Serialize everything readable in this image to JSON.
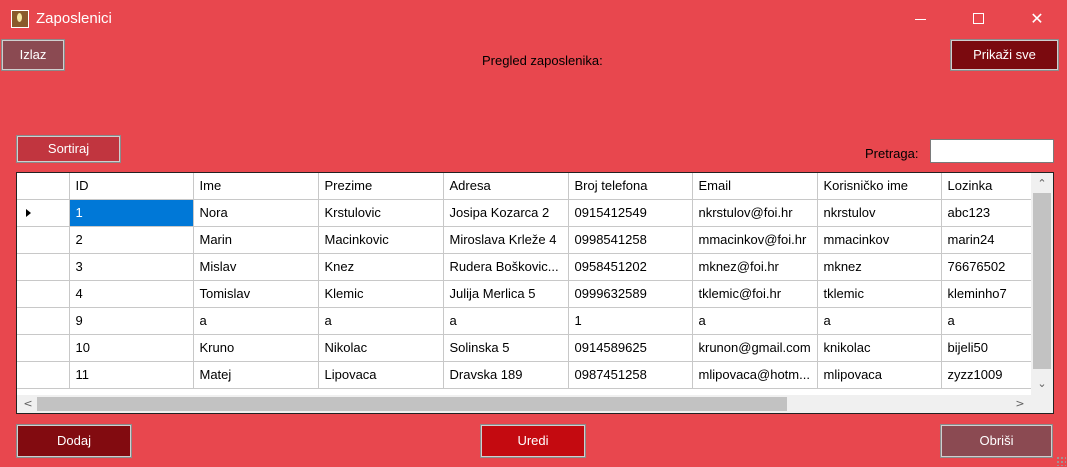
{
  "window": {
    "title": "Zaposlenici",
    "minimize_glyph": "—",
    "maximize_glyph": "☐",
    "close_glyph": "✕"
  },
  "toolbar": {
    "exit_label": "Izlaz",
    "show_all_label": "Prikaži sve",
    "sort_label": "Sortiraj"
  },
  "heading": "Pregled zaposlenika:",
  "search": {
    "label": "Pretraga:",
    "value": ""
  },
  "table": {
    "columns": [
      "ID",
      "Ime",
      "Prezime",
      "Adresa",
      "Broj telefona",
      "Email",
      "Korisničko ime",
      "Lozinka"
    ],
    "rows": [
      [
        "1",
        "Nora",
        "Krstulovic",
        "Josipa Kozarca 2",
        "0915412549",
        "nkrstulov@foi.hr",
        "nkrstulov",
        "abc123"
      ],
      [
        "2",
        "Marin",
        "Macinkovic",
        "Miroslava Krleže 4",
        "0998541258",
        "mmacinkov@foi.hr",
        "mmacinkov",
        "marin24"
      ],
      [
        "3",
        "Mislav",
        "Knez",
        "Rudera Boškovic...",
        "0958451202",
        "mknez@foi.hr",
        "mknez",
        "76676502"
      ],
      [
        "4",
        "Tomislav",
        "Klemic",
        "Julija Merlica 5",
        "0999632589",
        "tklemic@foi.hr",
        "tklemic",
        "kleminho7"
      ],
      [
        "9",
        "a",
        "a",
        "a",
        "1",
        "a",
        "a",
        "a"
      ],
      [
        "10",
        "Kruno",
        "Nikolac",
        "Solinska 5",
        "0914589625",
        "krunon@gmail.com",
        "knikolac",
        "bijeli50"
      ],
      [
        "11",
        "Matej",
        "Lipovaca",
        "Dravska 189",
        "0987451258",
        "mlipovaca@hotm...",
        "mlipovaca",
        "zyzz1009"
      ]
    ],
    "selected_row": 0
  },
  "actions": {
    "add_label": "Dodaj",
    "edit_label": "Uredi",
    "delete_label": "Obriši"
  },
  "colors": {
    "background": "#e8474e",
    "exit_button": "#8b4a52",
    "show_all_button": "#7b0a0f",
    "sort_button": "#c1353f",
    "add_button": "#820b10",
    "edit_button": "#c40a10",
    "delete_button": "#8b4a52",
    "selection": "#0078d7"
  }
}
